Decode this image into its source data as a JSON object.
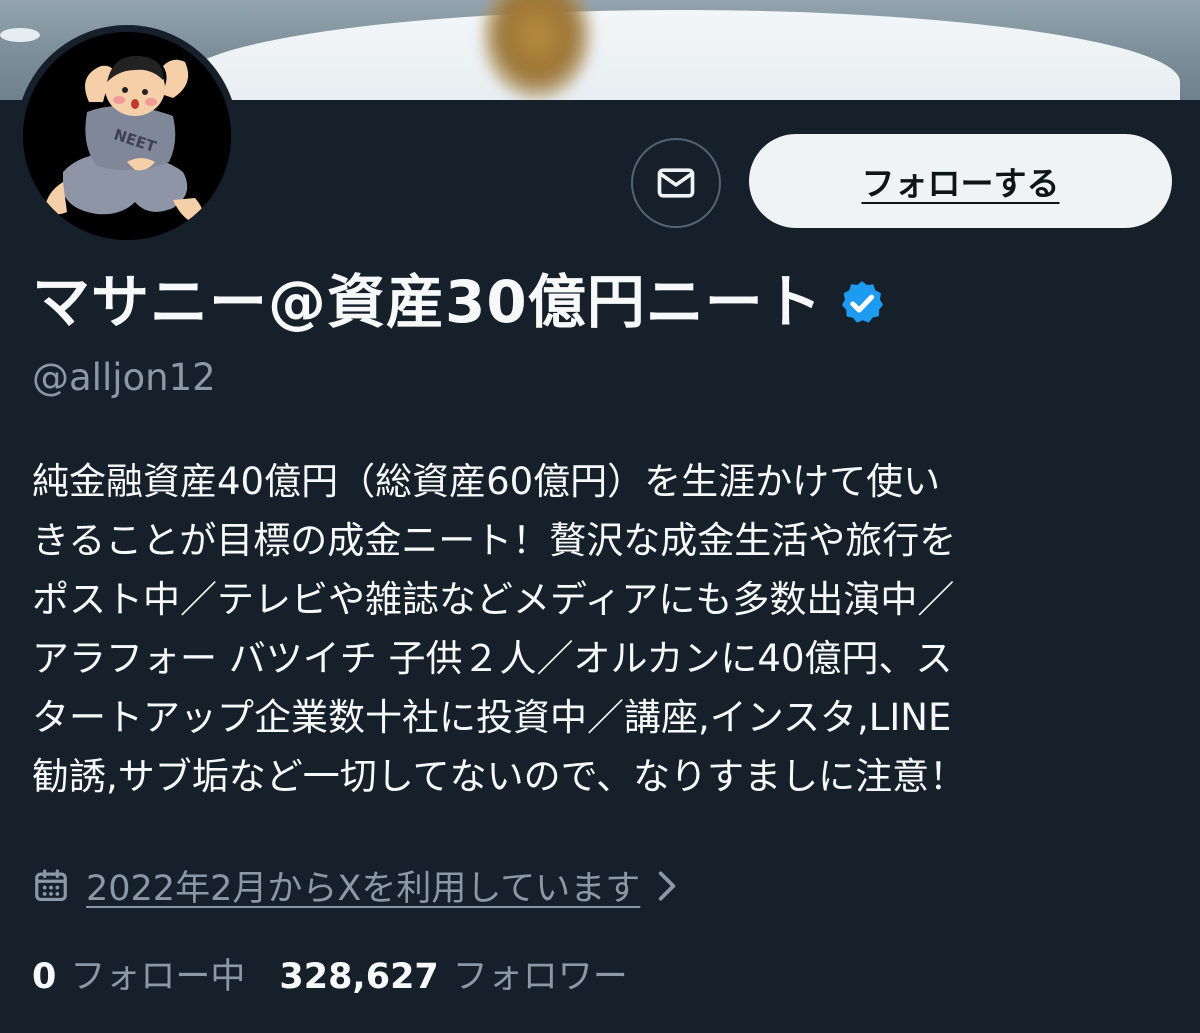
{
  "profile": {
    "display_name": "マサニー@資産30億円ニート",
    "handle": "@alljon12",
    "verified": true,
    "avatar_text": "NEET",
    "bio_lines": [
      "純金融資産40億円（総資産60億円）を生涯かけて使い",
      "きることが目標の成金ニート！贅沢な成金生活や旅行を",
      "ポスト中／テレビや雑誌などメディアにも多数出演中／",
      "アラフォー バツイチ 子供２人／オルカンに40億円、ス",
      "タートアップ企業数十社に投資中／講座,インスタ,LINE",
      "勧誘,サブ垢など一切してないので、なりすましに注意！"
    ],
    "joined": "2022年2月からXを利用しています",
    "following_count": "0",
    "following_label": "フォロー中",
    "followers_count": "328,627",
    "followers_label": "フォロワー"
  },
  "actions": {
    "message_icon": "envelope-icon",
    "follow_label": "フォローする"
  },
  "icons": {
    "verified": "verified-badge-icon",
    "calendar": "calendar-icon",
    "chevron": "chevron-right-icon"
  },
  "colors": {
    "background": "#15202b",
    "verified_blue": "#1d9bf0",
    "muted_text": "#8b98a5",
    "follow_button_bg": "#eff3f4"
  }
}
